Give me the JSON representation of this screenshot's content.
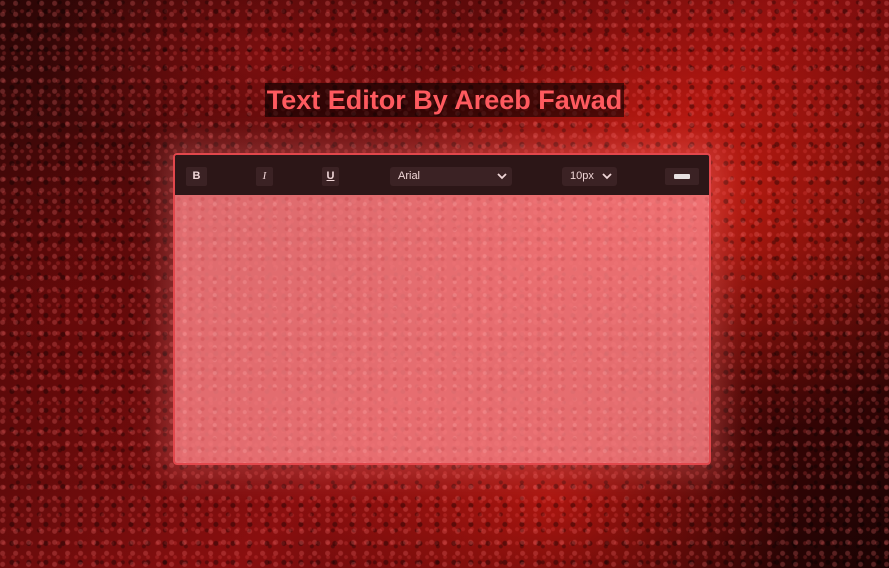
{
  "header": {
    "title": "Text Editor By Areeb Fawad"
  },
  "toolbar": {
    "bold_label": "B",
    "italic_label": "I",
    "underline_label": "U",
    "font_family_selected": "Arial",
    "font_size_selected": "10px",
    "color_value": "#e8e1e1"
  },
  "editor": {
    "content": ""
  },
  "colors": {
    "title": "#ff5a5f",
    "border": "#e2474c",
    "toolbar_bg": "#2c1617",
    "editor_bg": "#f57d80"
  }
}
